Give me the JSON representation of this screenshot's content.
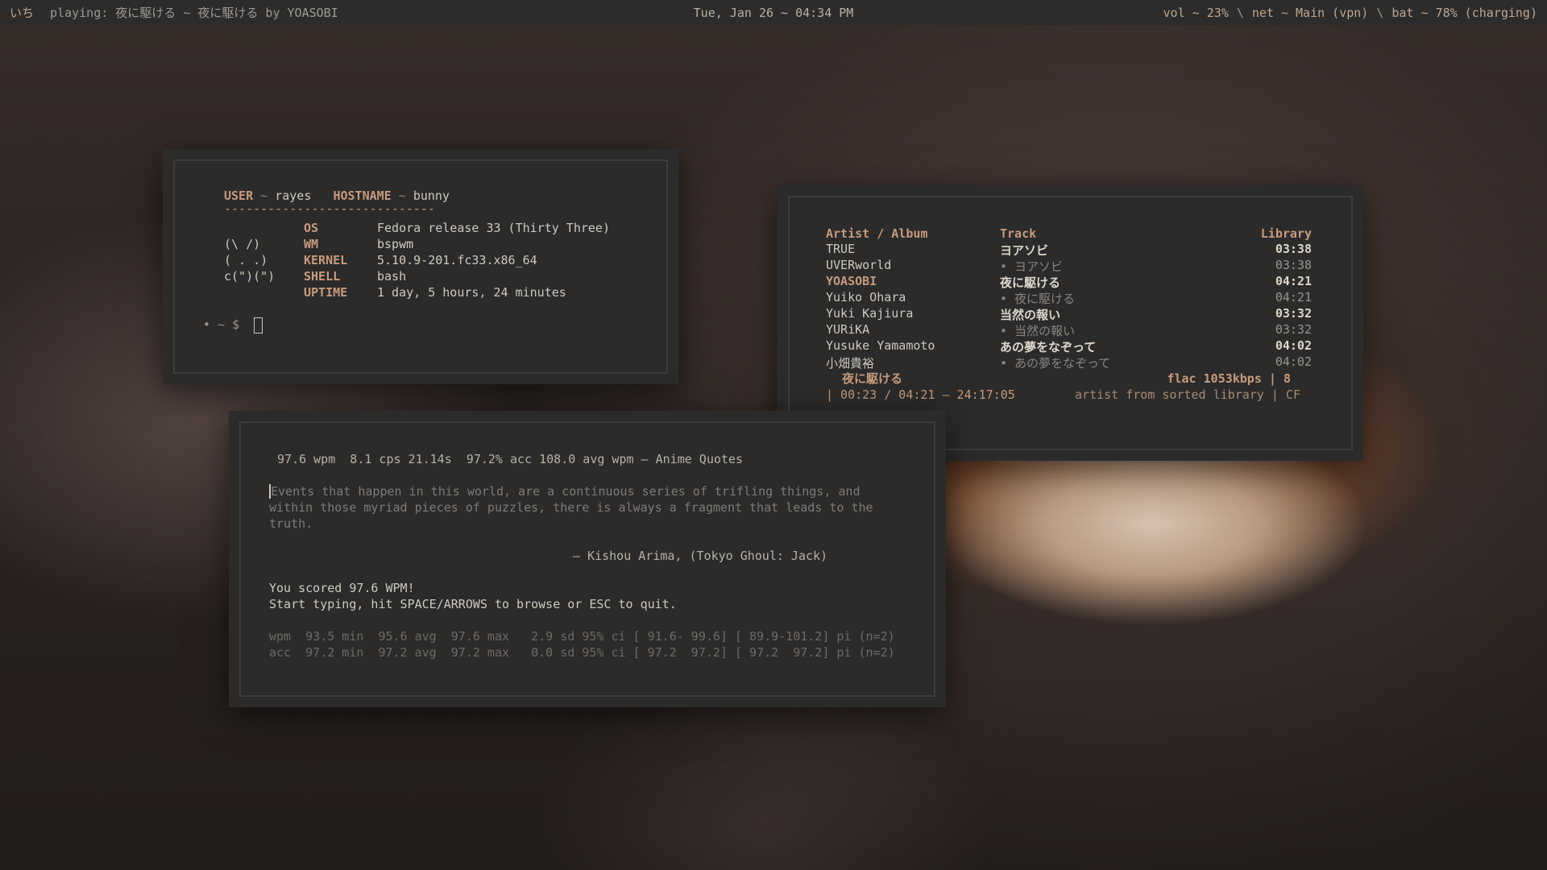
{
  "bar": {
    "workspace": "いち",
    "playing": "playing: 夜に駆ける ~ 夜に駆ける by YOASOBI",
    "datetime": "Tue, Jan 26  ~  04:34 PM",
    "vol": "vol ~ 23%",
    "net": "net ~ Main (vpn)",
    "bat": "bat ~ 78% (charging)",
    "separator": "\\"
  },
  "fetch": {
    "user_label": "USER",
    "user": "rayes",
    "host_label": "HOSTNAME",
    "host": "bunny",
    "tilde": "~",
    "rule": "-----------------------------",
    "ascii": [
      "(\\ /)",
      "( . .)",
      "c(\")(\")"
    ],
    "rows": [
      {
        "key": "OS",
        "value": "Fedora release 33 (Thirty Three)"
      },
      {
        "key": "WM",
        "value": "bspwm"
      },
      {
        "key": "KERNEL",
        "value": "5.10.9-201.fc33.x86_64"
      },
      {
        "key": "SHELL",
        "value": "bash"
      },
      {
        "key": "UPTIME",
        "value": "1 day, 5 hours, 24 minutes"
      }
    ],
    "prompt": "• ~ $"
  },
  "music": {
    "headers": {
      "artist": "Artist / Album",
      "track": "Track",
      "library": "Library"
    },
    "rows": [
      {
        "artist": "TRUE",
        "track": "ヨアソビ",
        "time": "03:38",
        "bold_time": true,
        "bold_artist": false,
        "sub": false
      },
      {
        "artist": "UVERworld",
        "track": "• ヨアソビ",
        "time": "03:38",
        "bold_time": false,
        "bold_artist": false,
        "sub": true
      },
      {
        "artist": "YOASOBI",
        "track": "夜に駆ける",
        "time": "04:21",
        "bold_time": true,
        "bold_artist": true,
        "sub": false
      },
      {
        "artist": "Yuiko Ohara",
        "track": "• 夜に駆ける",
        "time": "04:21",
        "bold_time": false,
        "bold_artist": false,
        "sub": true
      },
      {
        "artist": "Yuki Kajiura",
        "track": "当然の報い",
        "time": "03:32",
        "bold_time": true,
        "bold_artist": false,
        "sub": false
      },
      {
        "artist": "YURiKA",
        "track": "• 当然の報い",
        "time": "03:32",
        "bold_time": false,
        "bold_artist": false,
        "sub": true
      },
      {
        "artist": "Yusuke Yamamoto",
        "track": "あの夢をなぞって",
        "time": "04:02",
        "bold_time": true,
        "bold_artist": false,
        "sub": false
      },
      {
        "artist": "小畑貴裕",
        "track": "• あの夢をなぞって",
        "time": "04:02",
        "bold_time": false,
        "bold_artist": false,
        "sub": true
      }
    ],
    "now_title": "夜に駆ける",
    "now_format": "flac 1053kbps | 8",
    "progress": "| 00:23 / 04:21 — 24:17:05",
    "status": "artist from sorted library | CF"
  },
  "typing": {
    "stats": "97.6 wpm  8.1 cps 21.14s  97.2% acc 108.0 avg wpm — Anime Quotes",
    "quote_lines": [
      "Events that happen in this world, are a continuous series of trifling things, and",
      "within those myriad pieces of puzzles, there is always a fragment that leads to the",
      "truth."
    ],
    "attribution": "— Kishou Arima, (Tokyo Ghoul: Jack)",
    "score": "You scored 97.6 WPM!",
    "hint": "Start typing, hit SPACE/ARROWS to browse or ESC to quit.",
    "wpm_line": "wpm  93.5 min  95.6 avg  97.6 max   2.9 sd 95% ci [ 91.6- 99.6] [ 89.9-101.2] pi (n=2)",
    "acc_line": "acc  97.2 min  97.2 avg  97.2 max   0.0 sd 95% ci [ 97.2  97.2] [ 97.2  97.2] pi (n=2)"
  }
}
